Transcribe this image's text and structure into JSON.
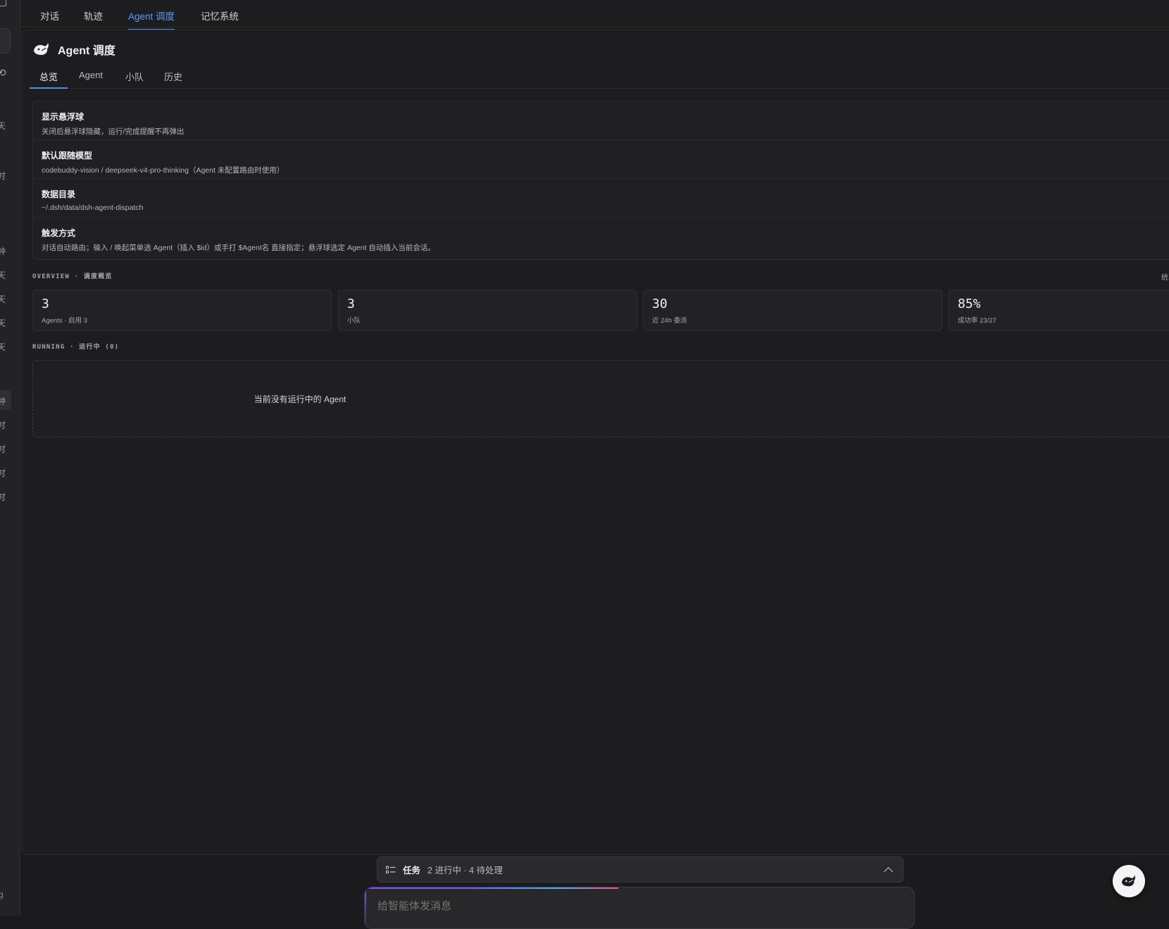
{
  "top_nav": {
    "tabs": [
      {
        "label": "对话"
      },
      {
        "label": "轨迹"
      },
      {
        "label": "Agent 调度"
      },
      {
        "label": "记忆系统"
      }
    ],
    "active": "Agent 调度"
  },
  "sidebar": {
    "visible_chars": [
      "天",
      "时",
      "钟",
      "天",
      "天",
      "天",
      "天",
      "钟",
      "时",
      "时",
      "时",
      "时"
    ],
    "bottom_char": "g"
  },
  "panel": {
    "title": "Agent 调度",
    "sub_tabs": [
      {
        "label": "总览"
      },
      {
        "label": "Agent"
      },
      {
        "label": "小队"
      },
      {
        "label": "历史"
      }
    ],
    "active_sub_tab": "总览",
    "settings": [
      {
        "title": "显示悬浮球",
        "desc": "关闭后悬浮球隐藏，运行/完成提醒不再弹出"
      },
      {
        "title": "默认跟随模型",
        "desc": "codebuddy-vision / deepseek-v4-pro-thinking（Agent 未配置路由时使用）"
      },
      {
        "title": "数据目录",
        "desc": "~/.dsh/data/dsh-agent-dispatch"
      },
      {
        "title": "触发方式",
        "desc": "对话自动路由；输入 / 唤起菜单选 Agent（插入 $id）或手打 $Agent名 直接指定；悬浮球选定 Agent 自动插入当前会话。"
      }
    ],
    "overview_label": "OVERVIEW · 调度概览",
    "overview_right": "统",
    "stats": [
      {
        "value": "3",
        "label": "Agents · 启用 3"
      },
      {
        "value": "3",
        "label": "小队"
      },
      {
        "value": "30",
        "label": "近 24h 委派"
      },
      {
        "value": "85%",
        "label": "成功率 23/27"
      }
    ],
    "running_label": "RUNNING · 运行中 (0)",
    "running_empty": "当前没有运行中的 Agent"
  },
  "task_bar": {
    "title": "任务",
    "status": "2 进行中 · 4 待处理"
  },
  "chat_input": {
    "placeholder": "给智能体发消息"
  },
  "colors": {
    "accent": "#4f8ff0",
    "background": "#1b1b1d"
  }
}
